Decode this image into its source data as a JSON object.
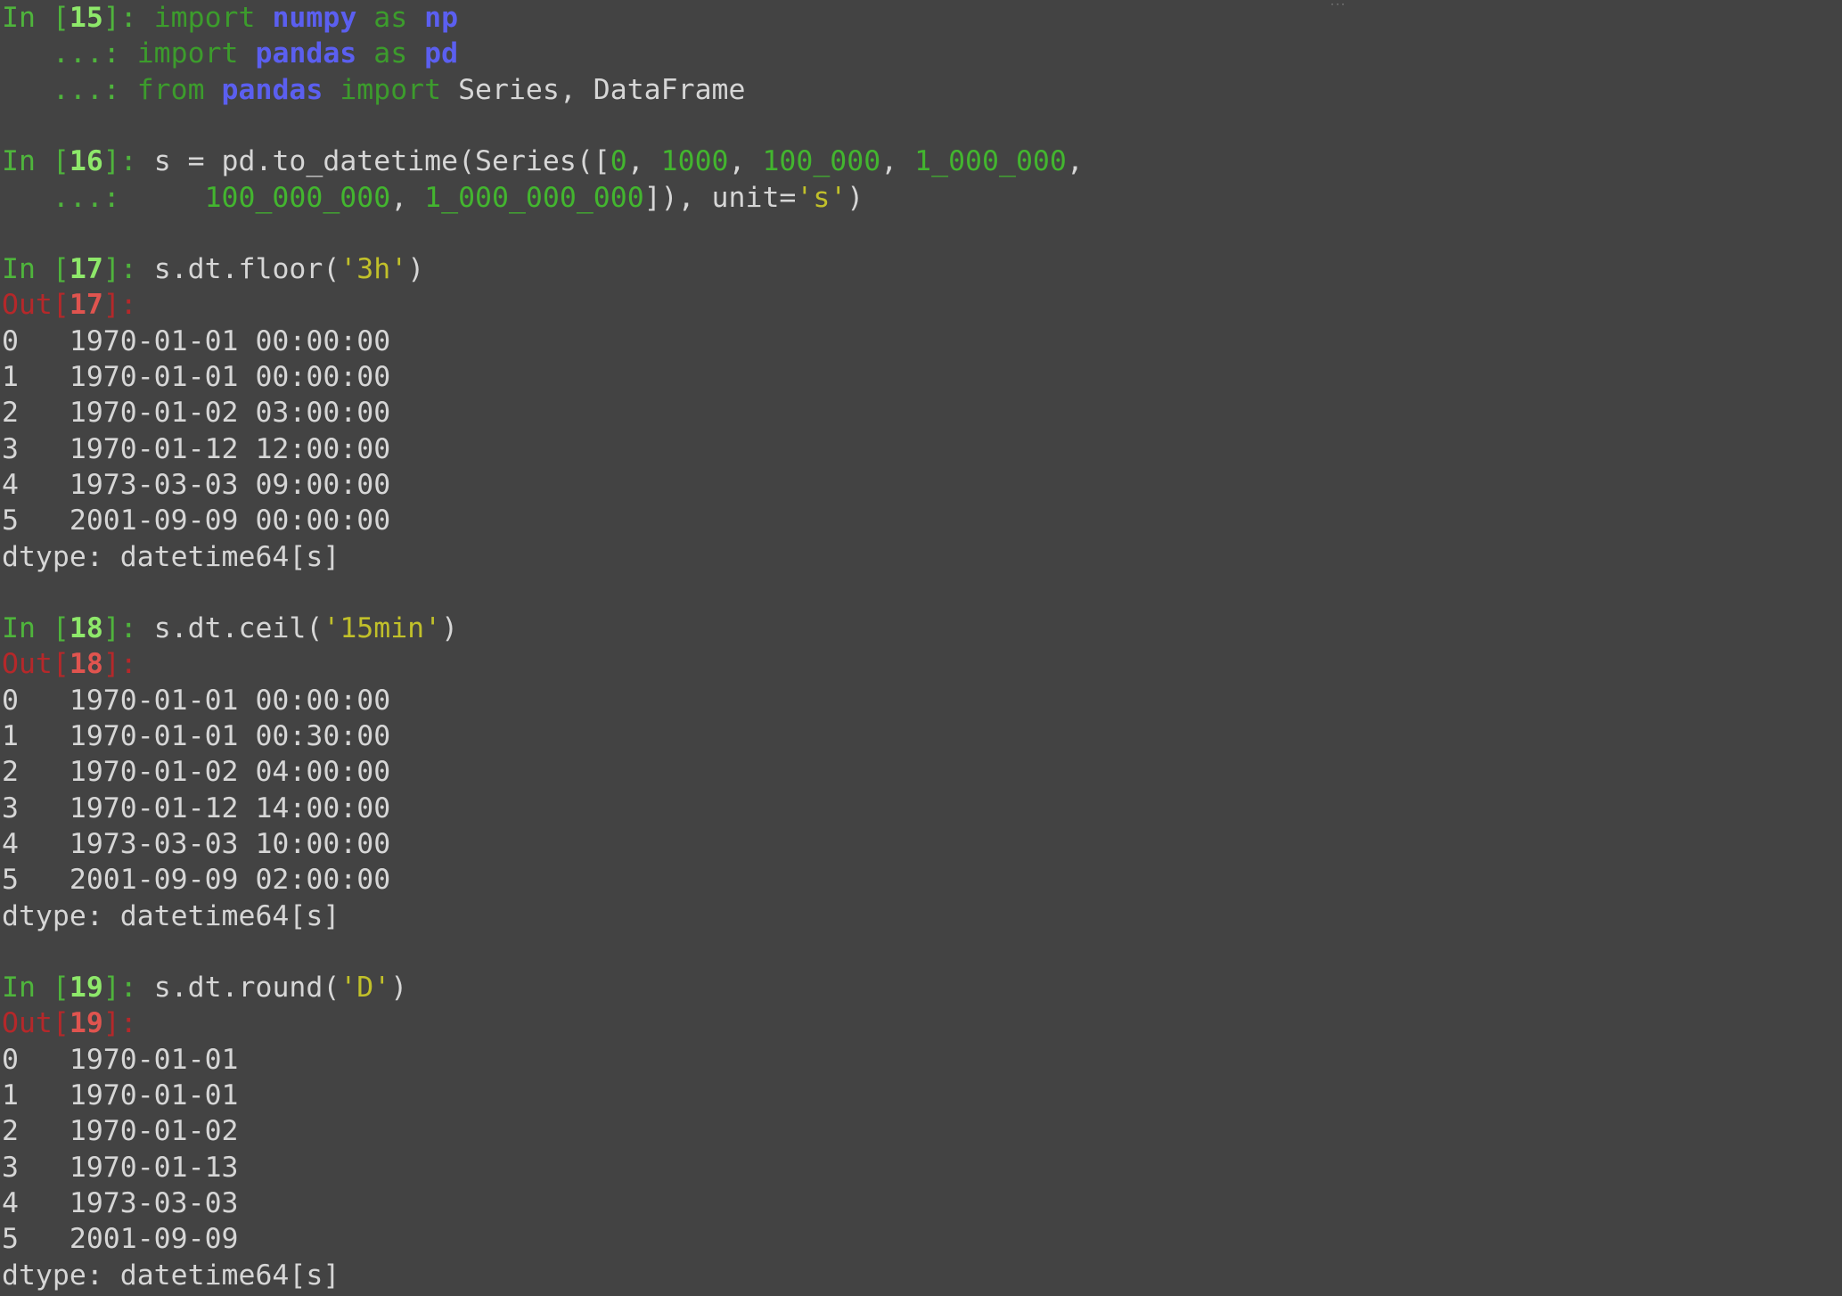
{
  "terminal": {
    "theme": {
      "background": "#434343",
      "text": "#d6d6d6",
      "prompt_in": "#4fb43c",
      "prompt_in_number": "#8ee86a",
      "prompt_out": "#b5282a",
      "prompt_out_number": "#e0544f",
      "keyword": "#3c9c2c",
      "module": "#5b5ff0",
      "number_literal": "#43b52f",
      "string_literal": "#c1c02a"
    },
    "corner_mark": "···",
    "lines": [
      [
        {
          "text": "In [",
          "k": "prompt-in"
        },
        {
          "text": "15",
          "k": "num-in"
        },
        {
          "text": "]: ",
          "k": "prompt-in"
        },
        {
          "text": "import",
          "k": "kw"
        },
        {
          "text": " ",
          "k": "plain"
        },
        {
          "text": "numpy",
          "k": "mod"
        },
        {
          "text": " ",
          "k": "plain"
        },
        {
          "text": "as",
          "k": "kw"
        },
        {
          "text": " ",
          "k": "plain"
        },
        {
          "text": "np",
          "k": "mod"
        }
      ],
      [
        {
          "text": "   ...: ",
          "k": "prompt-in"
        },
        {
          "text": "import",
          "k": "kw"
        },
        {
          "text": " ",
          "k": "plain"
        },
        {
          "text": "pandas",
          "k": "mod"
        },
        {
          "text": " ",
          "k": "plain"
        },
        {
          "text": "as",
          "k": "kw"
        },
        {
          "text": " ",
          "k": "plain"
        },
        {
          "text": "pd",
          "k": "mod"
        }
      ],
      [
        {
          "text": "   ...: ",
          "k": "prompt-in"
        },
        {
          "text": "from",
          "k": "kw"
        },
        {
          "text": " ",
          "k": "plain"
        },
        {
          "text": "pandas",
          "k": "mod"
        },
        {
          "text": " ",
          "k": "plain"
        },
        {
          "text": "import",
          "k": "kw"
        },
        {
          "text": " Series, DataFrame",
          "k": "plain"
        }
      ],
      [],
      [
        {
          "text": "In [",
          "k": "prompt-in"
        },
        {
          "text": "16",
          "k": "num-in"
        },
        {
          "text": "]: ",
          "k": "prompt-in"
        },
        {
          "text": "s = pd.to_datetime(Series([",
          "k": "plain"
        },
        {
          "text": "0",
          "k": "num"
        },
        {
          "text": ", ",
          "k": "plain"
        },
        {
          "text": "1000",
          "k": "num"
        },
        {
          "text": ", ",
          "k": "plain"
        },
        {
          "text": "100_000",
          "k": "num"
        },
        {
          "text": ", ",
          "k": "plain"
        },
        {
          "text": "1_000_000",
          "k": "num"
        },
        {
          "text": ",",
          "k": "plain"
        }
      ],
      [
        {
          "text": "   ...: ",
          "k": "prompt-in"
        },
        {
          "text": "    ",
          "k": "plain"
        },
        {
          "text": "100_000_000",
          "k": "num"
        },
        {
          "text": ", ",
          "k": "plain"
        },
        {
          "text": "1_000_000_000",
          "k": "num"
        },
        {
          "text": "]), unit=",
          "k": "plain"
        },
        {
          "text": "'s'",
          "k": "str"
        },
        {
          "text": ")",
          "k": "plain"
        }
      ],
      [],
      [
        {
          "text": "In [",
          "k": "prompt-in"
        },
        {
          "text": "17",
          "k": "num-in"
        },
        {
          "text": "]: ",
          "k": "prompt-in"
        },
        {
          "text": "s.dt.floor(",
          "k": "plain"
        },
        {
          "text": "'3h'",
          "k": "str"
        },
        {
          "text": ")",
          "k": "plain"
        }
      ],
      [
        {
          "text": "Out[",
          "k": "prompt-out"
        },
        {
          "text": "17",
          "k": "num-out"
        },
        {
          "text": "]:",
          "k": "prompt-out"
        }
      ],
      [
        {
          "text": "0   1970-01-01 00:00:00",
          "k": "plain"
        }
      ],
      [
        {
          "text": "1   1970-01-01 00:00:00",
          "k": "plain"
        }
      ],
      [
        {
          "text": "2   1970-01-02 03:00:00",
          "k": "plain"
        }
      ],
      [
        {
          "text": "3   1970-01-12 12:00:00",
          "k": "plain"
        }
      ],
      [
        {
          "text": "4   1973-03-03 09:00:00",
          "k": "plain"
        }
      ],
      [
        {
          "text": "5   2001-09-09 00:00:00",
          "k": "plain"
        }
      ],
      [
        {
          "text": "dtype: datetime64[s]",
          "k": "plain"
        }
      ],
      [],
      [
        {
          "text": "In [",
          "k": "prompt-in"
        },
        {
          "text": "18",
          "k": "num-in"
        },
        {
          "text": "]: ",
          "k": "prompt-in"
        },
        {
          "text": "s.dt.ceil(",
          "k": "plain"
        },
        {
          "text": "'15min'",
          "k": "str"
        },
        {
          "text": ")",
          "k": "plain"
        }
      ],
      [
        {
          "text": "Out[",
          "k": "prompt-out"
        },
        {
          "text": "18",
          "k": "num-out"
        },
        {
          "text": "]:",
          "k": "prompt-out"
        }
      ],
      [
        {
          "text": "0   1970-01-01 00:00:00",
          "k": "plain"
        }
      ],
      [
        {
          "text": "1   1970-01-01 00:30:00",
          "k": "plain"
        }
      ],
      [
        {
          "text": "2   1970-01-02 04:00:00",
          "k": "plain"
        }
      ],
      [
        {
          "text": "3   1970-01-12 14:00:00",
          "k": "plain"
        }
      ],
      [
        {
          "text": "4   1973-03-03 10:00:00",
          "k": "plain"
        }
      ],
      [
        {
          "text": "5   2001-09-09 02:00:00",
          "k": "plain"
        }
      ],
      [
        {
          "text": "dtype: datetime64[s]",
          "k": "plain"
        }
      ],
      [],
      [
        {
          "text": "In [",
          "k": "prompt-in"
        },
        {
          "text": "19",
          "k": "num-in"
        },
        {
          "text": "]: ",
          "k": "prompt-in"
        },
        {
          "text": "s.dt.round(",
          "k": "plain"
        },
        {
          "text": "'D'",
          "k": "str"
        },
        {
          "text": ")",
          "k": "plain"
        }
      ],
      [
        {
          "text": "Out[",
          "k": "prompt-out"
        },
        {
          "text": "19",
          "k": "num-out"
        },
        {
          "text": "]:",
          "k": "prompt-out"
        }
      ],
      [
        {
          "text": "0   1970-01-01",
          "k": "plain"
        }
      ],
      [
        {
          "text": "1   1970-01-01",
          "k": "plain"
        }
      ],
      [
        {
          "text": "2   1970-01-02",
          "k": "plain"
        }
      ],
      [
        {
          "text": "3   1970-01-13",
          "k": "plain"
        }
      ],
      [
        {
          "text": "4   1973-03-03",
          "k": "plain"
        }
      ],
      [
        {
          "text": "5   2001-09-09",
          "k": "plain"
        }
      ],
      [
        {
          "text": "dtype: datetime64[s]",
          "k": "plain"
        }
      ]
    ]
  }
}
